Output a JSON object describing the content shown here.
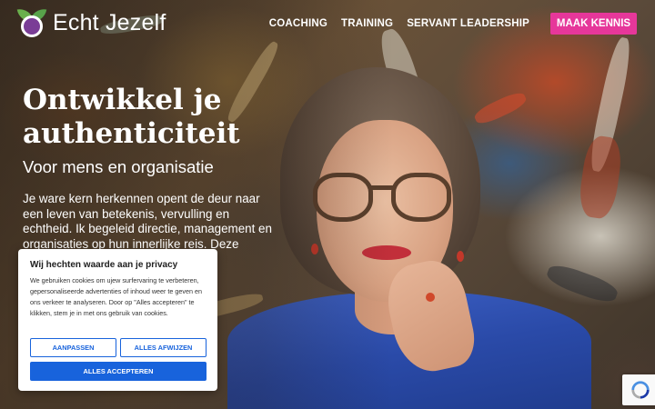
{
  "brand": {
    "name": "Echt Jezelf",
    "logo_icon": "leaf-person-logo"
  },
  "nav": {
    "items": [
      {
        "label": "COACHING"
      },
      {
        "label": "TRAINING"
      },
      {
        "label": "SERVANT LEADERSHIP"
      }
    ],
    "cta_label": "MAAK KENNIS"
  },
  "hero": {
    "title": "Ontwikkel je authenticiteit",
    "subtitle": "Voor mens en organisatie",
    "body": "Je ware kern herkennen opent de deur naar een leven van betekenis, vervulling en echtheid. Ik begeleid directie, management en organisaties op hun innerlijke reis. Deze"
  },
  "cookie_banner": {
    "title": "Wij hechten waarde aan je privacy",
    "text": "We gebruiken cookies om ujew surfervaring te verbeteren, gepersonaliseerde advertenties of inhoud weer te geven en ons verkeer te analyseren. Door op \"Alles accepteren\" te klikken, stem je in met ons gebruik van cookies.",
    "customize_label": "AANPASSEN",
    "reject_label": "ALLES AFWIJZEN",
    "accept_label": "ALLES ACCEPTEREN"
  },
  "colors": {
    "cta": "#e6379a",
    "cookie_primary": "#1863dc",
    "logo_purple": "#7a3d96",
    "logo_green": "#6ab04c"
  },
  "icons": {
    "recaptcha": "recaptcha-icon"
  }
}
